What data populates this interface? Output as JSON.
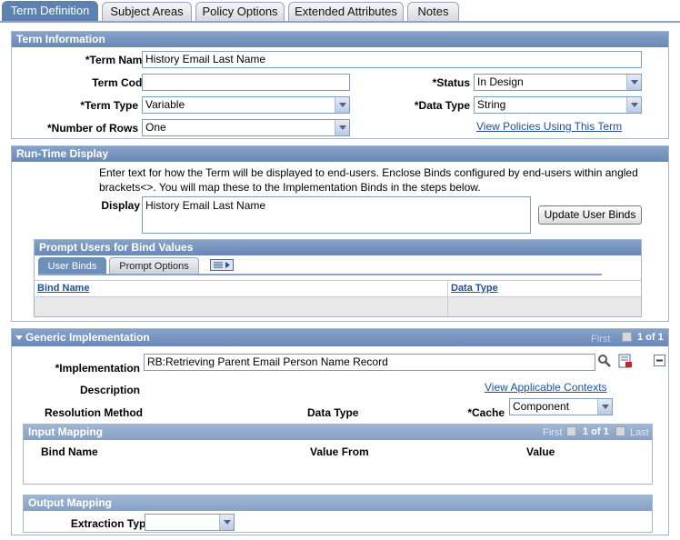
{
  "tabs": [
    {
      "label": "Term Definition",
      "active": true
    },
    {
      "label": "Subject Areas"
    },
    {
      "label": "Policy Options"
    },
    {
      "label": "Extended Attributes"
    },
    {
      "label": "Notes"
    }
  ],
  "term_info": {
    "title": "Term Information",
    "term_name_label": "*Term Name",
    "term_name_value": "History Email Last Name",
    "term_code_label": "Term Code",
    "term_code_value": "",
    "status_label": "*Status",
    "status_value": "In Design",
    "term_type_label": "*Term Type",
    "term_type_value": "Variable",
    "data_type_label": "*Data Type",
    "data_type_value": "String",
    "rows_label": "*Number of Rows",
    "rows_value": "One",
    "policies_link": "View Policies Using This Term"
  },
  "runtime": {
    "title": "Run-Time Display",
    "instructions_1": "Enter text for how the Term will be displayed to end-users. Enclose Binds configured by end-users within angled",
    "instructions_2": "brackets<>. You will map these to the Implementation Binds in the steps below.",
    "display_label": "Display",
    "display_value": "History Email Last Name",
    "update_button": "Update User Binds",
    "prompt": {
      "title": "Prompt Users for Bind Values",
      "tab_user_binds": "User Binds",
      "tab_prompt_options": "Prompt Options",
      "col_bind_name": "Bind Name",
      "col_data_type": "Data Type"
    }
  },
  "generic": {
    "title": "Generic Implementation",
    "nav_first": "First",
    "nav_count": "1 of 1",
    "implementation_label": "*Implementation",
    "implementation_value": "RB:Retrieving Parent Email Person Name Record",
    "description_label": "Description",
    "contexts_link": "View Applicable Contexts",
    "resolution_label": "Resolution Method",
    "data_type_label": "Data Type",
    "cache_label": "*Cache",
    "cache_value": "Component",
    "input_mapping": {
      "title": "Input Mapping",
      "nav_first": "First",
      "nav_count": "1 of 1",
      "nav_last": "Last",
      "col_bind_name": "Bind Name",
      "col_value_from": "Value From",
      "col_value": "Value"
    },
    "output_mapping": {
      "title": "Output Mapping",
      "extraction_label": "Extraction Type",
      "extraction_value": ""
    }
  },
  "colors": {
    "header_blue": "#6a88b6",
    "link_blue": "#1e4f9e",
    "active_tab": "#5e82b0"
  }
}
